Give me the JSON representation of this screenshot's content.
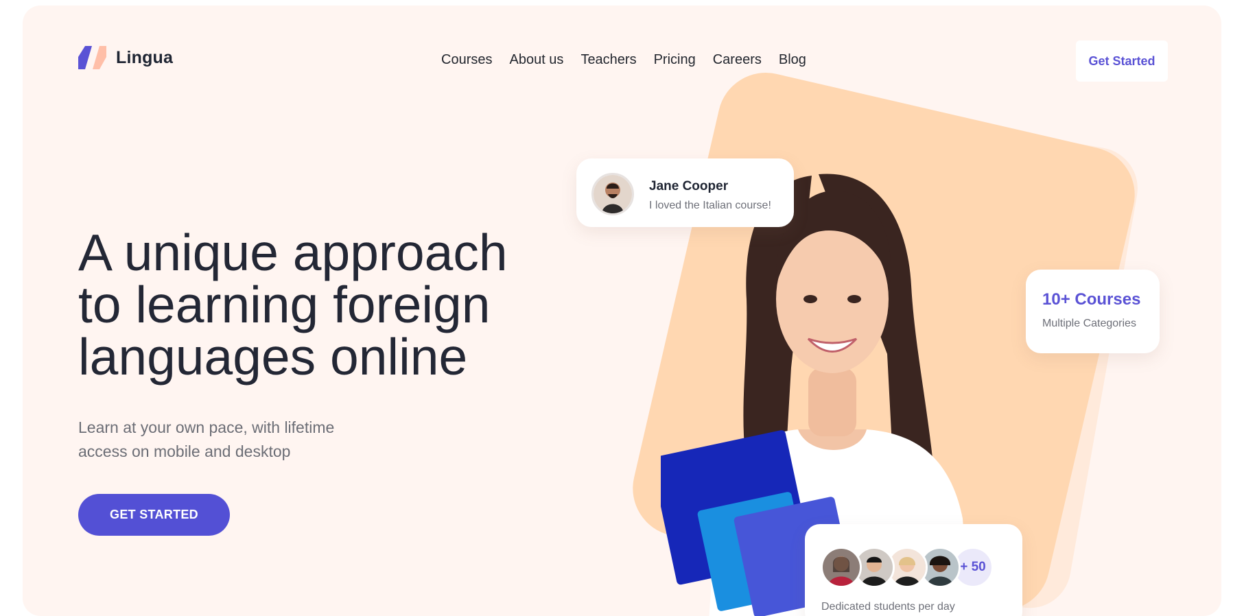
{
  "brand": {
    "name": "Lingua",
    "icon": "lingua-logo-icon",
    "colors": {
      "primary": "#5a52d5",
      "secondary": "#ffbfa8"
    }
  },
  "nav": {
    "items": [
      {
        "label": "Courses"
      },
      {
        "label": "About us"
      },
      {
        "label": "Teachers"
      },
      {
        "label": "Pricing"
      },
      {
        "label": "Careers"
      },
      {
        "label": "Blog"
      }
    ]
  },
  "header": {
    "cta_label": "Get Started"
  },
  "hero": {
    "title_lines": [
      "A unique approach",
      "to learning foreign",
      "languages online"
    ],
    "subtitle_lines": [
      "Learn at your own pace, with lifetime",
      "access on mobile and desktop"
    ],
    "cta_label": "GET STARTED"
  },
  "review_card": {
    "name": "Jane Cooper",
    "text": "I loved the Italian course!"
  },
  "courses_card": {
    "title": "10+ Courses",
    "subtitle": "Multiple Categories"
  },
  "students_card": {
    "more_badge": "+ 50",
    "caption": "Dedicated students per day"
  },
  "colors": {
    "background": "#fff5f1",
    "accent": "#5350d5",
    "shape_front": "#ffd7b1",
    "shape_back": "#ffeadb"
  }
}
